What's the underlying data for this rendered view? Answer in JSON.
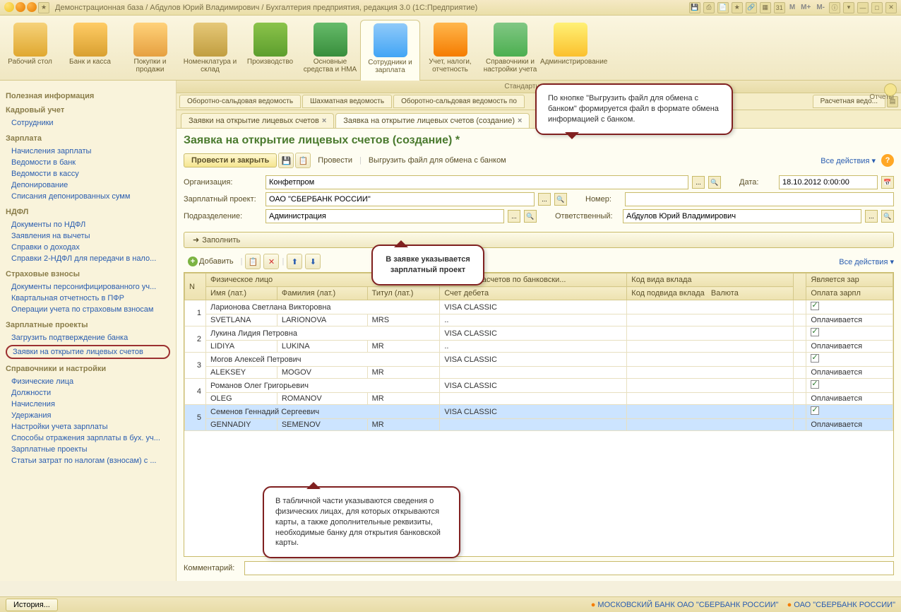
{
  "title": "Демонстрационная база / Абдулов Юрий Владимирович / Бухгалтерия предприятия, редакция 3.0   (1С:Предприятие)",
  "mainToolbar": [
    {
      "label": "Рабочий стол",
      "iconClass": "icon-desktop"
    },
    {
      "label": "Банк и касса",
      "iconClass": "icon-bank"
    },
    {
      "label": "Покупки и продажи",
      "iconClass": "icon-shop"
    },
    {
      "label": "Номенклатура и склад",
      "iconClass": "icon-nom"
    },
    {
      "label": "Производство",
      "iconClass": "icon-prod"
    },
    {
      "label": "Основные средства и НМА",
      "iconClass": "icon-osn"
    },
    {
      "label": "Сотрудники и зарплата",
      "iconClass": "icon-sotr",
      "active": true
    },
    {
      "label": "Учет, налоги, отчетность",
      "iconClass": "icon-nalog"
    },
    {
      "label": "Справочники и настройки учета",
      "iconClass": "icon-sprav"
    },
    {
      "label": "Администрирование",
      "iconClass": "icon-admin"
    }
  ],
  "stdReportsLabel": "Стандартные отчеты",
  "quickReportsLabel": "Отчеты",
  "subtabs": [
    "Оборотно-сальдовая ведомость",
    "Шахматная ведомость",
    "Оборотно-сальдовая ведомость по"
  ],
  "rightSubtab": "Расчетная ведо...",
  "sidebar": {
    "groups": [
      {
        "title": "Полезная информация",
        "items": []
      },
      {
        "title": "Кадровый учет",
        "items": [
          "Сотрудники"
        ]
      },
      {
        "title": "Зарплата",
        "items": [
          "Начисления зарплаты",
          "Ведомости в банк",
          "Ведомости в кассу",
          "Депонирование",
          "Списания депонированных сумм"
        ]
      },
      {
        "title": "НДФЛ",
        "items": [
          "Документы по НДФЛ",
          "Заявления на вычеты",
          "Справки о доходах",
          "Справки 2-НДФЛ для передачи в нало..."
        ]
      },
      {
        "title": "Страховые взносы",
        "items": [
          "Документы персонифицированного уч...",
          "Квартальная отчетность в ПФР",
          "Операции учета по страховым взносам"
        ]
      },
      {
        "title": "Зарплатные проекты",
        "items": [
          "Загрузить подтверждение банка",
          "Заявки на открытие лицевых счетов"
        ],
        "circled": 1
      },
      {
        "title": "Справочники и настройки",
        "items": [
          "Физические лица",
          "Должности",
          "Начисления",
          "Удержания",
          "Настройки учета зарплаты",
          "Способы отражения зарплаты в бух. уч...",
          "Зарплатные проекты",
          "Статьи затрат по налогам (взносам) с ..."
        ]
      }
    ]
  },
  "docTabs": [
    {
      "label": "Заявки на открытие лицевых счетов"
    },
    {
      "label": "Заявка на открытие лицевых счетов (создание)",
      "active": true
    }
  ],
  "docTitle": "Заявка на открытие лицевых счетов (создание) *",
  "docToolbar": {
    "primary": "Провести и закрыть",
    "post": "Провести",
    "export": "Выгрузить файл для обмена с банком",
    "allActions": "Все действия"
  },
  "form": {
    "org": {
      "label": "Организация:",
      "value": "Конфетпром"
    },
    "project": {
      "label": "Зарплатный проект:",
      "value": "ОАО \"СБЕРБАНК РОССИИ\""
    },
    "dept": {
      "label": "Подразделение:",
      "value": "Администрация"
    },
    "date": {
      "label": "Дата:",
      "value": "18.10.2012 0:00:00"
    },
    "number": {
      "label": "Номер:",
      "value": ""
    },
    "resp": {
      "label": "Ответственный:",
      "value": "Абдулов Юрий Владимирович"
    }
  },
  "fillBtn": "Заполнить",
  "tableToolbar": {
    "add": "Добавить",
    "allActions": "Все действия"
  },
  "columns": {
    "n": "N",
    "person": "Физическое лицо",
    "nameLat": "Имя (лат.)",
    "surnameLat": "Фамилия (лат.)",
    "titleLat": "Титул (лат.)",
    "system": "Система расчетов по банковски...",
    "debit": "Счет дебета",
    "depositCode": "Код вида вклада",
    "subCode": "Код подвида вклада",
    "currency": "Валюта",
    "isSalary": "Является зар",
    "payment": "Оплата зарпл"
  },
  "rows": [
    {
      "n": 1,
      "person": "Ларионова Светлана Викторовна",
      "nameLat": "SVETLANA",
      "surnameLat": "LARIONOVA",
      "titleLat": "MRS",
      "system": "VISA CLASSIC",
      "debit": "..",
      "checked": true,
      "pay": "Оплачивается"
    },
    {
      "n": 2,
      "person": "Лукина Лидия Петровна",
      "nameLat": "LIDIYA",
      "surnameLat": "LUKINA",
      "titleLat": "MR",
      "system": "VISA CLASSIC",
      "debit": "..",
      "checked": true,
      "pay": "Оплачивается"
    },
    {
      "n": 3,
      "person": "Могов Алексей Петрович",
      "nameLat": "ALEKSEY",
      "surnameLat": "MOGOV",
      "titleLat": "MR",
      "system": "VISA CLASSIC",
      "debit": "",
      "checked": true,
      "pay": "Оплачивается"
    },
    {
      "n": 4,
      "person": "Романов Олег Григорьевич",
      "nameLat": "OLEG",
      "surnameLat": "ROMANOV",
      "titleLat": "MR",
      "system": "VISA CLASSIC",
      "debit": "",
      "checked": true,
      "pay": "Оплачивается"
    },
    {
      "n": 5,
      "person": "Семенов Геннадий Сергеевич",
      "nameLat": "GENNADIY",
      "surnameLat": "SEMENOV",
      "titleLat": "MR",
      "system": "VISA CLASSIC",
      "debit": "",
      "checked": true,
      "pay": "Оплачивается",
      "sel": true
    }
  ],
  "commentLabel": "Комментарий:",
  "callouts": {
    "c1": "По кнопке \"Выгрузить файл для обмена с банком\" формируется файл в формате обмена информацией с банком.",
    "c2": "В заявке указывается зарплатный проект",
    "c3": "В табличной части указываются сведения о физических лицах, для которых открываются карты, а также дополнительные реквизиты, необходимые банку для открытия банковской карты."
  },
  "statusbar": {
    "history": "История...",
    "bank1": "МОСКОВСКИЙ БАНК ОАО \"СБЕРБАНК РОССИИ\"",
    "bank2": "ОАО \"СБЕРБАНК РОССИИ\""
  }
}
